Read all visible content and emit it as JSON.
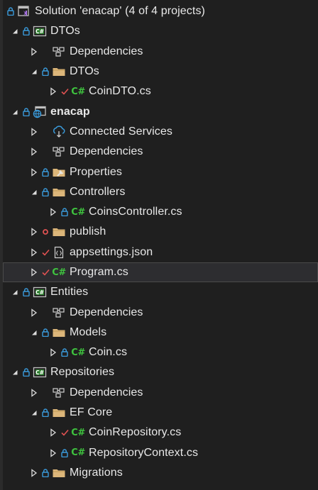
{
  "tree": {
    "solution_label": "Solution 'enacap' (4 of 4 projects)",
    "items": [
      {
        "key": "dtos-project",
        "label": "DTOs"
      },
      {
        "key": "dtos-deps",
        "label": "Dependencies"
      },
      {
        "key": "dtos-folder",
        "label": "DTOs"
      },
      {
        "key": "coindto",
        "label": "CoinDTO.cs"
      },
      {
        "key": "enacap-project",
        "label": "enacap"
      },
      {
        "key": "connected",
        "label": "Connected Services"
      },
      {
        "key": "enacap-deps",
        "label": "Dependencies"
      },
      {
        "key": "properties",
        "label": "Properties"
      },
      {
        "key": "controllers",
        "label": "Controllers"
      },
      {
        "key": "coinscontroller",
        "label": "CoinsController.cs"
      },
      {
        "key": "publish",
        "label": "publish"
      },
      {
        "key": "appsettings",
        "label": "appsettings.json"
      },
      {
        "key": "program",
        "label": "Program.cs"
      },
      {
        "key": "entities-project",
        "label": "Entities"
      },
      {
        "key": "entities-deps",
        "label": "Dependencies"
      },
      {
        "key": "models",
        "label": "Models"
      },
      {
        "key": "coin",
        "label": "Coin.cs"
      },
      {
        "key": "repositories-project",
        "label": "Repositories"
      },
      {
        "key": "repositories-deps",
        "label": "Dependencies"
      },
      {
        "key": "efcore",
        "label": "EF Core"
      },
      {
        "key": "coinrepository",
        "label": "CoinRepository.cs"
      },
      {
        "key": "repositorycontext",
        "label": "RepositoryContext.cs"
      },
      {
        "key": "migrations",
        "label": "Migrations"
      }
    ]
  },
  "colors": {
    "background": "#1f1f1f",
    "text": "#e8e8e8",
    "lock_blue": "#3a9bdc",
    "check_red": "#e05252",
    "folder_tan": "#dcb67a",
    "csharp_green": "#3fc43f",
    "selected_bg": "#2d2d30"
  },
  "icons": {
    "solution": "visual-studio-solution-icon",
    "csharp_project": "csharp-project-icon",
    "web_project": "web-project-icon",
    "dependencies": "dependencies-icon",
    "folder": "folder-icon",
    "csharp_file": "csharp-file-icon",
    "json_file": "json-file-icon",
    "connected_services": "connected-services-icon",
    "properties": "properties-icon",
    "lock": "lock-icon",
    "checkmark": "pending-edit-check-icon",
    "added_dot": "pending-add-dot-icon",
    "expand": "expand-arrow-icon",
    "collapse": "collapse-arrow-icon",
    "csharp_glyph": "C#"
  }
}
